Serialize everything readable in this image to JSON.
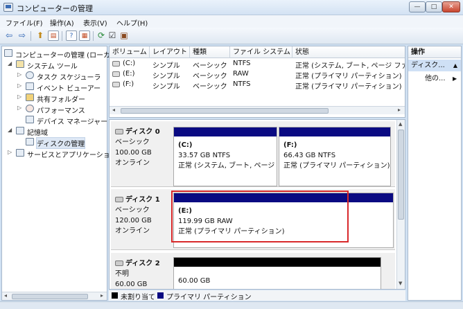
{
  "window": {
    "title": "コンピューターの管理"
  },
  "menu": [
    "ファイル(F)",
    "操作(A)",
    "表示(V)",
    "ヘルプ(H)"
  ],
  "tree": {
    "root": "コンピューターの管理 (ローカ",
    "system_tools": "システム ツール",
    "task_scheduler": "タスク スケジューラ",
    "event_viewer": "イベント ビューアー",
    "shared_folders": "共有フォルダー",
    "performance": "パフォーマンス",
    "device_manager": "デバイス マネージャー",
    "storage": "記憶域",
    "disk_management": "ディスクの管理",
    "services_apps": "サービスとアプリケーショ"
  },
  "volume_list": {
    "headers": [
      "ボリューム",
      "レイアウト",
      "種類",
      "ファイル システム",
      "状態"
    ],
    "rows": [
      [
        "(C:)",
        "シンプル",
        "ベーシック",
        "NTFS",
        "正常 (システム, ブート, ページ ファイ"
      ],
      [
        "(E:)",
        "シンプル",
        "ベーシック",
        "RAW",
        "正常 (プライマリ パーティション)"
      ],
      [
        "(F:)",
        "シンプル",
        "ベーシック",
        "NTFS",
        "正常 (プライマリ パーティション)"
      ]
    ]
  },
  "disks": [
    {
      "title": "ディスク 0",
      "type": "ベーシック",
      "size": "100.00 GB",
      "status": "オンライン",
      "partitions": [
        {
          "name": "(C:)",
          "size": "33.57 GB NTFS",
          "status": "正常 (システム, ブート, ページ"
        },
        {
          "name": "(F:)",
          "size": "66.43 GB NTFS",
          "status": "正常 (プライマリ パーティション)"
        }
      ]
    },
    {
      "title": "ディスク 1",
      "type": "ベーシック",
      "size": "120.00 GB",
      "status": "オンライン",
      "partitions": [
        {
          "name": "(E:)",
          "size": "119.99 GB RAW",
          "status": "正常 (プライマリ パーティション)"
        }
      ]
    },
    {
      "title": "ディスク 2",
      "type": "不明",
      "size": "60.00 GB",
      "status": "",
      "partitions": [
        {
          "name": "",
          "size": "60.00 GB",
          "status": ""
        }
      ]
    }
  ],
  "legend": {
    "unallocated": "未割り当て",
    "primary": "プライマリ パーティション",
    "unallocated_color": "#000000",
    "primary_color": "#0a0a82"
  },
  "actions": {
    "header": "操作",
    "selected": "ディスク...",
    "other": "他の..."
  },
  "toolbar_icons": [
    "back-icon",
    "forward-icon",
    "up-folder-icon",
    "show-hide-tree-icon",
    "help-icon",
    "view-icon",
    "refresh-icon",
    "properties-icon",
    "export-icon"
  ]
}
